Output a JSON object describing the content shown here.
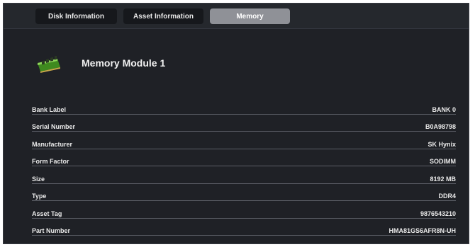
{
  "tabs": [
    {
      "label": "Disk Information",
      "active": false
    },
    {
      "label": "Asset Information",
      "active": false
    },
    {
      "label": "Memory",
      "active": true
    }
  ],
  "module": {
    "title": "Memory Module 1",
    "icon": "memory-module-icon"
  },
  "properties": [
    {
      "label": "Bank Label",
      "value": "BANK 0"
    },
    {
      "label": "Serial Number",
      "value": "B0A98798"
    },
    {
      "label": "Manufacturer",
      "value": "SK Hynix"
    },
    {
      "label": "Form Factor",
      "value": "SODIMM"
    },
    {
      "label": "Size",
      "value": "8192 MB"
    },
    {
      "label": "Type",
      "value": "DDR4"
    },
    {
      "label": "Asset Tag",
      "value": "9876543210"
    },
    {
      "label": "Part Number",
      "value": "HMA81GS6AFR8N-UH"
    }
  ],
  "colors": {
    "background": "#1f2126",
    "tab_bar": "#25282d",
    "tab": "#16181c",
    "tab_active": "#8f9197",
    "divider": "#5b5e66",
    "module_pcb": "#6cbf3c"
  }
}
